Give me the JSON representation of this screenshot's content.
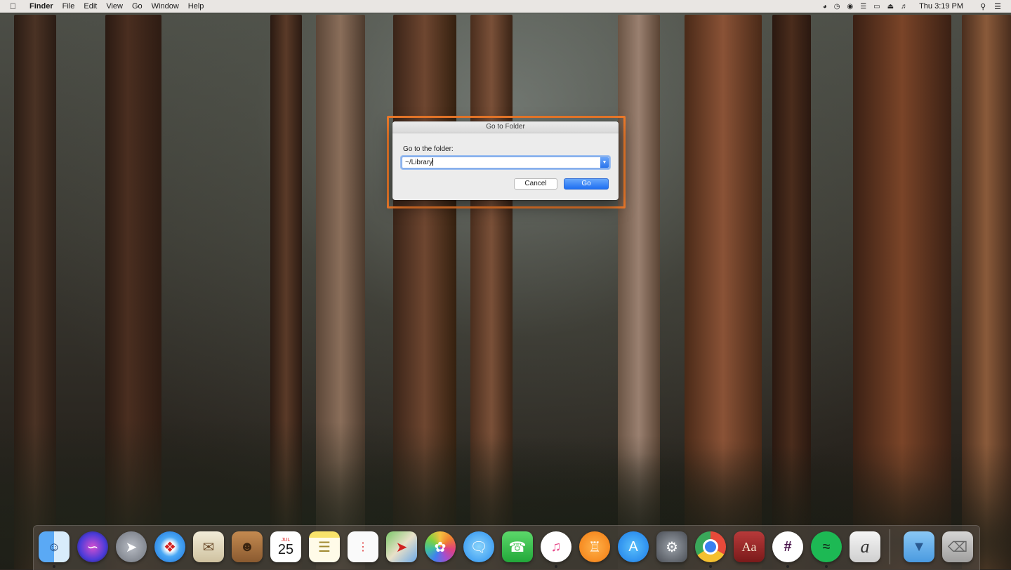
{
  "menubar": {
    "app_name": "Finder",
    "menus": [
      "File",
      "Edit",
      "View",
      "Go",
      "Window",
      "Help"
    ],
    "clock": "Thu 3:19 PM",
    "status_icons": [
      "creative-cloud-icon",
      "time-machine-icon",
      "vpn-icon",
      "wifi-icon",
      "airplay-icon",
      "eject-icon",
      "volume-icon"
    ]
  },
  "dialog": {
    "title": "Go to Folder",
    "prompt": "Go to the folder:",
    "path_value": "~/Library",
    "cancel_label": "Cancel",
    "go_label": "Go",
    "highlight_color": "#ee7a2a"
  },
  "dock": {
    "calendar_month": "JUL",
    "calendar_day": "25",
    "dictionary_glyph": "Aa",
    "apps": [
      "finder",
      "siri",
      "launchpad",
      "safari",
      "mail",
      "contacts",
      "calendar",
      "notes",
      "reminders",
      "maps",
      "photos",
      "messages",
      "facetime",
      "itunes",
      "ibooks",
      "app-store",
      "system-preferences",
      "chrome",
      "dictionary",
      "slack",
      "spotify",
      "script-editor",
      "downloads-folder",
      "trash"
    ]
  }
}
